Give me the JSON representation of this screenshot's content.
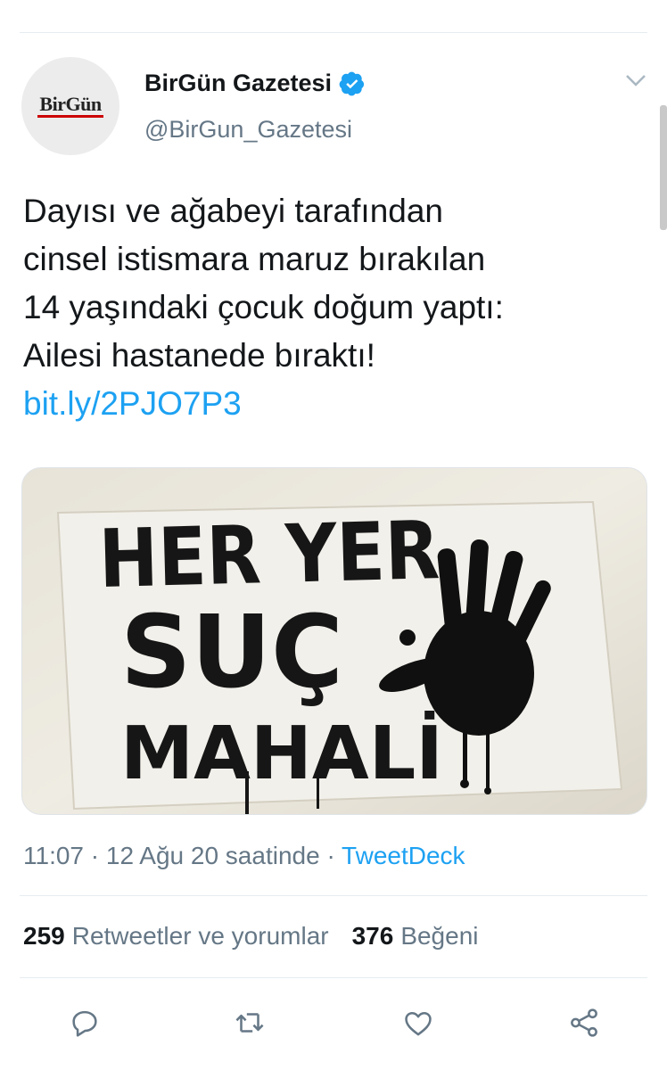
{
  "user": {
    "name": "BirGün Gazetesi",
    "handle": "@BirGun_Gazetesi",
    "logo_part1": "BirGün",
    "verified_icon": "verified-badge-icon"
  },
  "tweet": {
    "lines": [
      "Dayısı ve ağabeyi tarafından",
      "cinsel istismara maruz bırakılan",
      "14 yaşındaki çocuk doğum yaptı:",
      "Ailesi hastanede bıraktı!"
    ],
    "link": "bit.ly/2PJO7P3"
  },
  "image": {
    "line1": "HER YER",
    "line2": "SUÇ",
    "line3": "MAHALİ"
  },
  "meta": {
    "time": "11:07",
    "dot1": "·",
    "date": "12 Ağu 20 saatinde",
    "dot2": "·",
    "source": "TweetDeck"
  },
  "stats": {
    "retweets_count": "259",
    "retweets_label": "Retweetler ve yorumlar",
    "likes_count": "376",
    "likes_label": "Beğeni"
  },
  "colors": {
    "accent": "#1da1f2",
    "secondary_text": "#657786",
    "logo_red": "#cc0000"
  },
  "actions": [
    "reply-icon",
    "retweet-icon",
    "like-icon",
    "share-icon"
  ]
}
